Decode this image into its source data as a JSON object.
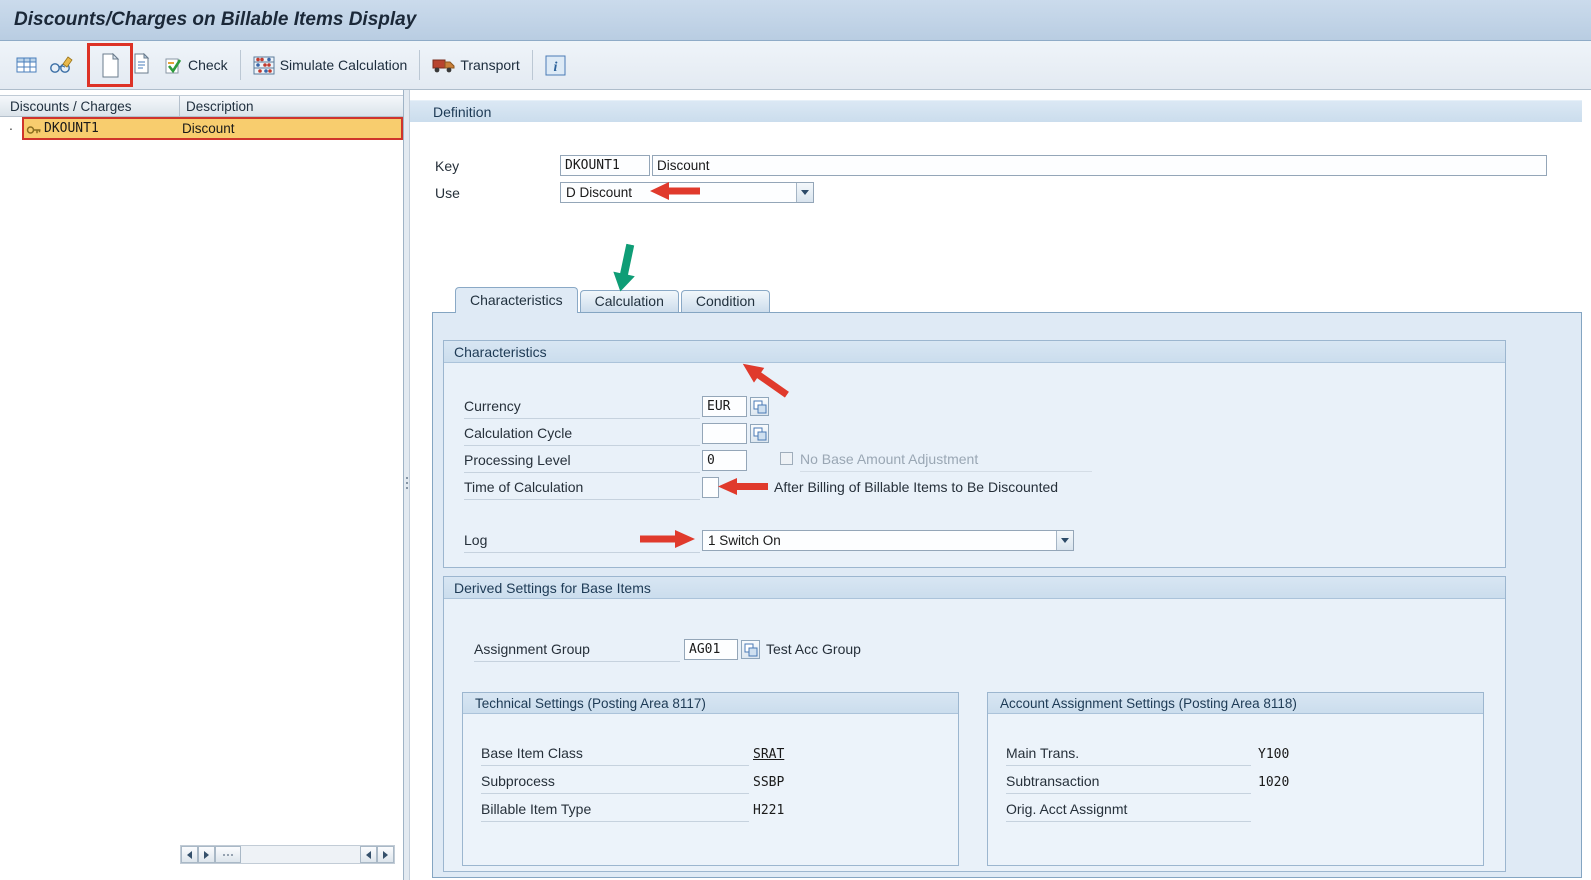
{
  "titlebar": {
    "title": "Discounts/Charges on Billable Items Display"
  },
  "toolbar": {
    "check_label": "Check",
    "simulate_label": "Simulate Calculation",
    "transport_label": "Transport"
  },
  "left_panel": {
    "columns": [
      "Discounts / Charges",
      "Description"
    ],
    "bullet": "·",
    "row": {
      "key": "DKOUNT1",
      "description": "Discount"
    }
  },
  "definition": {
    "title": "Definition",
    "key_label": "Key",
    "key_value": "DKOUNT1",
    "key_description": "Discount",
    "use_label": "Use",
    "use_value": "D Discount"
  },
  "tabs": [
    {
      "label": "Characteristics"
    },
    {
      "label": "Calculation"
    },
    {
      "label": "Condition"
    }
  ],
  "characteristics": {
    "title": "Characteristics",
    "currency": {
      "label": "Currency",
      "value": "EUR"
    },
    "calculation_cycle": {
      "label": "Calculation Cycle",
      "value": ""
    },
    "processing_level": {
      "label": "Processing Level",
      "value": "0"
    },
    "no_base_amount": {
      "label": "No Base Amount Adjustment",
      "checked": false
    },
    "time_of_calculation": {
      "label": "Time of Calculation",
      "value": "",
      "description": "After Billing of Billable Items to Be Discounted"
    },
    "log": {
      "label": "Log",
      "value": "1 Switch On"
    }
  },
  "derived_settings": {
    "title": "Derived Settings for Base Items",
    "assignment_group": {
      "label": "Assignment Group",
      "value": "AG01",
      "description": "Test Acc Group"
    },
    "technical": {
      "title": "Technical Settings (Posting Area 8117)",
      "rows": [
        {
          "label": "Base Item Class",
          "value": "SRAT"
        },
        {
          "label": "Subprocess",
          "value": "SSBP"
        },
        {
          "label": "Billable Item Type",
          "value": "H221"
        }
      ]
    },
    "account": {
      "title": "Account Assignment Settings (Posting Area 8118)",
      "rows": [
        {
          "label": "Main Trans.",
          "value": "Y100"
        },
        {
          "label": "Subtransaction",
          "value": "1020"
        },
        {
          "label": "Orig. Acct Assignmt",
          "value": ""
        }
      ]
    }
  },
  "colors": {
    "annotation_red": "#e03a2c",
    "annotation_green": "#0f9d76",
    "selection_orange": "#f8cd6e",
    "section_header_blue": "#cfe0f0"
  }
}
